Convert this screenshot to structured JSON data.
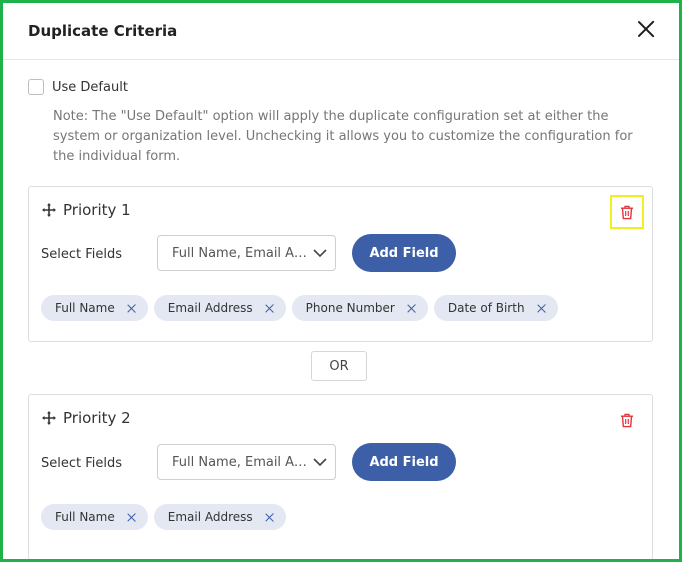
{
  "dialog": {
    "title": "Duplicate Criteria",
    "close_icon": "close-icon"
  },
  "use_default": {
    "label": "Use Default",
    "checked": false,
    "note": "Note: The \"Use Default\" option will apply the duplicate configuration set at either the system or organization level. Unchecking it allows you to customize the configuration for the individual form."
  },
  "priorities": [
    {
      "title": "Priority 1",
      "select_label": "Select Fields",
      "select_value": "Full Name, Email Address, Phone Number, Date of Birth",
      "add_button": "Add Field",
      "chips": [
        "Full Name",
        "Email Address",
        "Phone Number",
        "Date of Birth"
      ],
      "delete_highlighted": true
    },
    {
      "title": "Priority 2",
      "select_label": "Select Fields",
      "select_value": "Full Name, Email Address",
      "add_button": "Add Field",
      "chips": [
        "Full Name",
        "Email Address"
      ],
      "delete_highlighted": false
    }
  ],
  "separator": {
    "label": "OR"
  },
  "colors": {
    "accent": "#3c5fa8",
    "chip_bg": "#e3e8f2",
    "delete": "#e0353b",
    "frame": "#1fb14a",
    "highlight": "#f2ee22"
  }
}
